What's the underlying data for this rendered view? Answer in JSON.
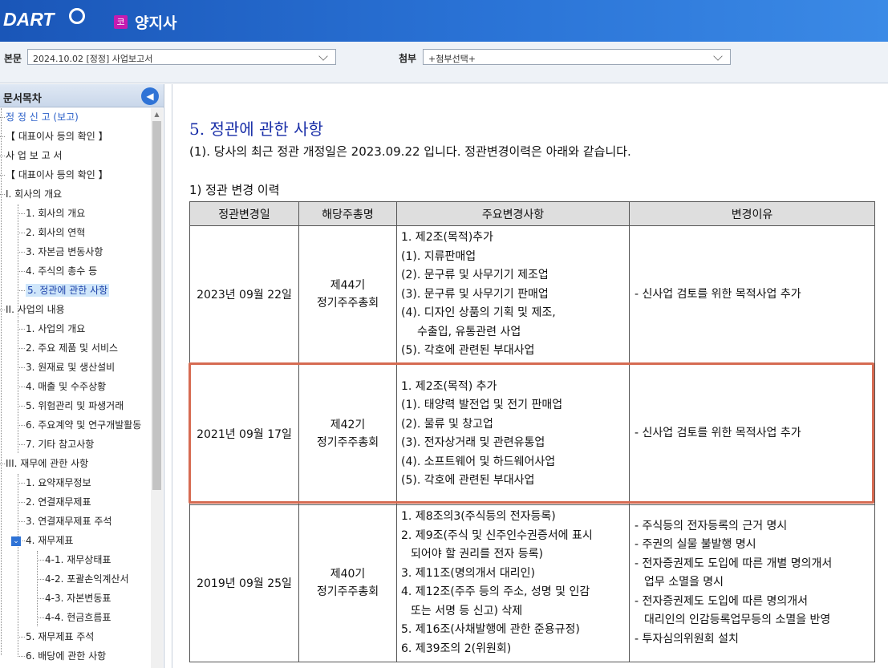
{
  "header": {
    "logo": "DART",
    "corp_badge": "코",
    "corp_name": "양지사"
  },
  "toolbar": {
    "body_label": "본문",
    "body_select": "2024.10.02 [정정] 사업보고서",
    "attach_label": "첨부",
    "attach_select": "+첨부선택+"
  },
  "sidebar": {
    "title": "문서목차",
    "items": [
      {
        "label": "정 정 신 고 (보고)"
      },
      {
        "label": "【 대표이사 등의 확인 】"
      },
      {
        "label": "사 업 보 고 서"
      },
      {
        "label": "【 대표이사 등의 확인 】"
      },
      {
        "label": "I. 회사의 개요"
      },
      {
        "label": "1. 회사의 개요"
      },
      {
        "label": "2. 회사의 연혁"
      },
      {
        "label": "3. 자본금 변동사항"
      },
      {
        "label": "4. 주식의 총수 등"
      },
      {
        "label": "5. 정관에 관한 사항"
      },
      {
        "label": "II. 사업의 내용"
      },
      {
        "label": "1. 사업의 개요"
      },
      {
        "label": "2. 주요 제품 및 서비스"
      },
      {
        "label": "3. 원재료 및 생산설비"
      },
      {
        "label": "4. 매출 및 수주상황"
      },
      {
        "label": "5. 위험관리 및 파생거래"
      },
      {
        "label": "6. 주요계약 및 연구개발활동"
      },
      {
        "label": "7. 기타 참고사항"
      },
      {
        "label": "III. 재무에 관한 사항"
      },
      {
        "label": "1. 요약재무정보"
      },
      {
        "label": "2. 연결재무제표"
      },
      {
        "label": "3. 연결재무제표 주석"
      },
      {
        "label": "4. 재무제표"
      },
      {
        "label": "4-1. 재무상태표"
      },
      {
        "label": "4-2. 포괄손익계산서"
      },
      {
        "label": "4-3. 자본변동표"
      },
      {
        "label": "4-4. 현금흐름표"
      },
      {
        "label": "5. 재무제표 주석"
      },
      {
        "label": "6. 배당에 관한 사항"
      }
    ]
  },
  "content": {
    "section_title": "5. 정관에 관한 사항",
    "paragraph": "(1). 당사의 최근 정관 개정일은 2023.09.22 입니다. 정관변경이력은 아래와 같습니다.",
    "subheading": "1) 정관 변경 이력",
    "table": {
      "headers": [
        "정관변경일",
        "해당주총명",
        "주요변경사항",
        "변경이유"
      ],
      "rows": [
        {
          "date": "2023년 09월 22일",
          "meeting_1": "제44기",
          "meeting_2": "정기주주총회",
          "changes": [
            "1. 제2조(목적)추가",
            "(1). 지류판매업",
            "(2). 문구류 및 사무기기 제조업",
            "(3). 문구류 및 사무기기 판매업",
            "(4). 디자인 상품의 기획 및 제조,",
            "수출입, 유통관련 사업",
            "(5). 각호에 관련된 부대사업"
          ],
          "reasons": [
            "- 신사업 검토를 위한 목적사업 추가"
          ]
        },
        {
          "date": "2021년 09월 17일",
          "meeting_1": "제42기",
          "meeting_2": "정기주주총회",
          "changes": [
            "1. 제2조(목적) 추가",
            "(1). 태양력 발전업 및 전기 판매업",
            "(2). 물류 및 창고업",
            "(3). 전자상거래 및 관련유통업",
            "(4). 소프트웨어 및 하드웨어사업",
            "(5). 각호에 관련된 부대사업"
          ],
          "reasons": [
            "- 신사업 검토를 위한 목적사업 추가"
          ]
        },
        {
          "date": "2019년 09월 25일",
          "meeting_1": "제40기",
          "meeting_2": "정기주주총회",
          "changes": [
            "1. 제8조의3(주식등의 전자등록)",
            "2. 제9조(주식 및 신주인수권증서에 표시",
            "되어야 할 권리를 전자 등록)",
            "3. 제11조(명의개서 대리인)",
            "4. 제12조(주주 등의 주소, 성명 및 인감",
            "또는 서명 등 신고) 삭제",
            "5. 제16조(사채발행에 관한 준용규정)",
            "6. 제39조의 2(위원회)"
          ],
          "reasons": [
            "- 주식등의 전자등록의 근거 명시",
            "- 주권의 실물 불발행 명시",
            "- 전자증권제도 도입에 따른 개별 명의개서",
            "업무 소멸을 명시",
            "- 전자증권제도 도입에 따른 명의개서",
            "대리인의 인감등록업무등의 소멸을 반영",
            "- 투자심의위원회 설치"
          ]
        }
      ]
    }
  }
}
